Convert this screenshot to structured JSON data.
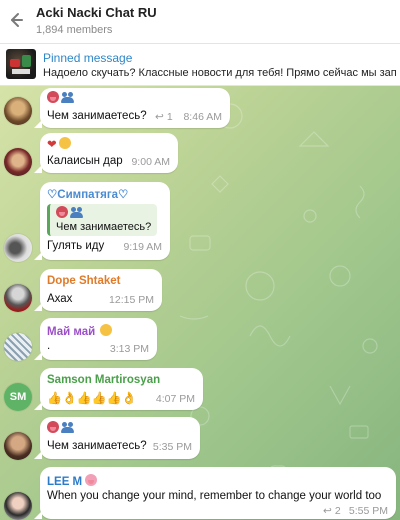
{
  "header": {
    "title": "Acki Nacki Chat RU",
    "members": "1,894 members"
  },
  "pinned": {
    "title": "Pinned message",
    "text": "Надоело скучать? Классные новости для тебя!  Прямо сейчас мы зап"
  },
  "messages": [
    {
      "text": "Чем занимаетесь?",
      "time": "8:46 AM",
      "reply_count": "1",
      "reactions": [
        "lungs-emoji",
        "people-emoji"
      ]
    },
    {
      "text": "Калаисын дар",
      "time": "9:00 AM",
      "reactions": [
        "heart-emoji",
        "face-emoji"
      ]
    },
    {
      "sender": "♡Симпатяга♡",
      "sender_color": "#4a8bd1",
      "quote_text": "Чем занимаетесь?",
      "text": "Гулять иду",
      "time": "9:19 AM"
    },
    {
      "sender": "Dope Shtaket",
      "sender_color": "#e07b29",
      "text": "Ахах",
      "time": "12:15 PM"
    },
    {
      "sender": "Май май",
      "sender_color": "#9b4fc6",
      "text": ".",
      "time": "3:13 PM"
    },
    {
      "sender": "Samson Martirosyan",
      "sender_color": "#4aa04a",
      "avatar_initials": "SM",
      "text": "👍👌👍👍👍👌",
      "time": "4:07 PM"
    },
    {
      "text": "Чем занимаетесь?",
      "time": "5:35 PM",
      "reactions": [
        "lungs-emoji",
        "people-emoji"
      ]
    },
    {
      "sender": "LEE M",
      "sender_color": "#2c7bc9",
      "text": "When you change your mind, remember to change your world too",
      "time": "5:55 PM",
      "reply_count": "2"
    }
  ],
  "colors": {
    "accent": "#2f87c8",
    "chat_bg_start": "#d6e3a8",
    "chat_bg_end": "#86b57e"
  }
}
